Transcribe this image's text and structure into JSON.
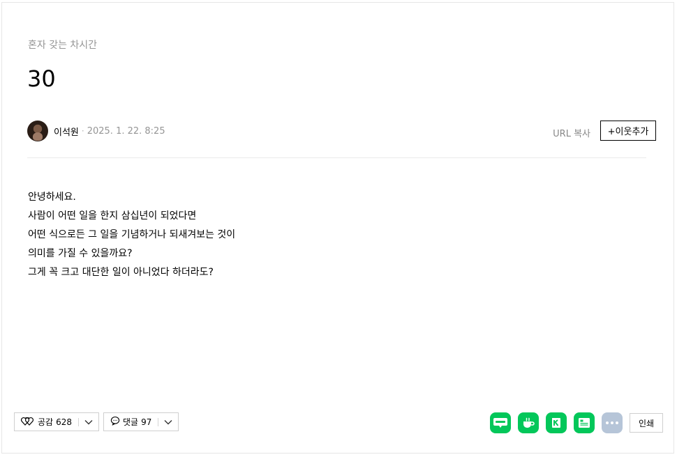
{
  "post": {
    "category": "혼자 갖는 차시간",
    "title": "30",
    "author": "이석원",
    "separator": "·",
    "date": "2025. 1. 22. 8:25",
    "body_lines": [
      "안녕하세요.",
      "사람이 어떤 일을 한지 삼십년이 되었다면",
      "어떤 식으로든 그 일을 기념하거나 되새겨보는 것이",
      "의미를 가질 수 있을까요?",
      "그게 꼭 크고 대단한 일이 아니었다 하더라도?"
    ]
  },
  "header_actions": {
    "url_copy": "URL 복사",
    "add_neighbor": "+이웃추가"
  },
  "footer": {
    "like": {
      "label": "공감",
      "count": "628"
    },
    "comment": {
      "label": "댓글",
      "count": "97"
    },
    "share_icons": [
      "blog-share-icon",
      "cafe-share-icon",
      "keep-share-icon",
      "memo-share-icon",
      "more-share-icon"
    ],
    "print": "인쇄"
  },
  "colors": {
    "share_green": "#03c75a",
    "share_more": "#b6c5d8",
    "category_gray": "#959595"
  }
}
